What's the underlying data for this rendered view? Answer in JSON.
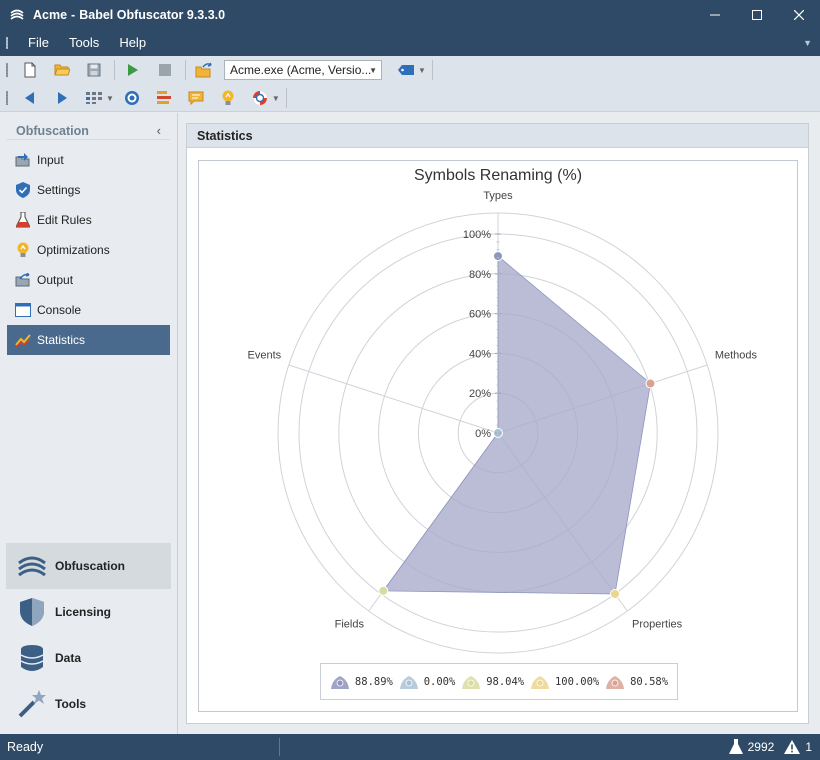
{
  "window": {
    "app_name": "Acme",
    "separator": "-",
    "product": "Babel Obfuscator 9.3.3.0"
  },
  "menu": {
    "items": [
      "File",
      "Tools",
      "Help"
    ]
  },
  "toolbar": {
    "assembly_combo": "Acme.exe (Acme, Versio..."
  },
  "sidebar": {
    "header": "Obfuscation",
    "items": [
      {
        "label": "Input",
        "icon": "input-icon"
      },
      {
        "label": "Settings",
        "icon": "shield-check-icon"
      },
      {
        "label": "Edit Rules",
        "icon": "flask-icon"
      },
      {
        "label": "Optimizations",
        "icon": "bulb-icon"
      },
      {
        "label": "Output",
        "icon": "output-icon"
      },
      {
        "label": "Console",
        "icon": "console-icon"
      },
      {
        "label": "Statistics",
        "icon": "statistics-icon"
      }
    ],
    "active_item": "Statistics",
    "nav_panels": [
      {
        "label": "Obfuscation",
        "icon": "obfuscation-icon"
      },
      {
        "label": "Licensing",
        "icon": "licensing-shield-icon"
      },
      {
        "label": "Data",
        "icon": "database-icon"
      },
      {
        "label": "Tools",
        "icon": "wand-icon"
      }
    ],
    "active_panel": "Obfuscation"
  },
  "main": {
    "header": "Statistics"
  },
  "chart_data": {
    "type": "radar",
    "title": "Symbols Renaming (%)",
    "categories": [
      "Types",
      "Methods",
      "Properties",
      "Fields",
      "Events"
    ],
    "values": [
      88.89,
      80.58,
      100.0,
      98.04,
      0.0
    ],
    "rlim": [
      0,
      100
    ],
    "radial_ticks": [
      "0%",
      "20%",
      "40%",
      "60%",
      "80%",
      "100%"
    ],
    "grid": true,
    "legend_position": "bottom",
    "legend": [
      {
        "label": "88.89%",
        "color": "#8f95bd"
      },
      {
        "label": "0.00%",
        "color": "#a9c3d6"
      },
      {
        "label": "98.04%",
        "color": "#d9dca0"
      },
      {
        "label": "100.00%",
        "color": "#ecd58f"
      },
      {
        "label": "80.58%",
        "color": "#d9a394"
      }
    ],
    "fill_color": "#a7abc9",
    "point_colors": [
      "#8f95bd",
      "#d9a394",
      "#ecd58f",
      "#d9dca0",
      "#a9c3d6"
    ]
  },
  "status": {
    "text": "Ready",
    "test_count": "2992",
    "warning_count": "1"
  }
}
